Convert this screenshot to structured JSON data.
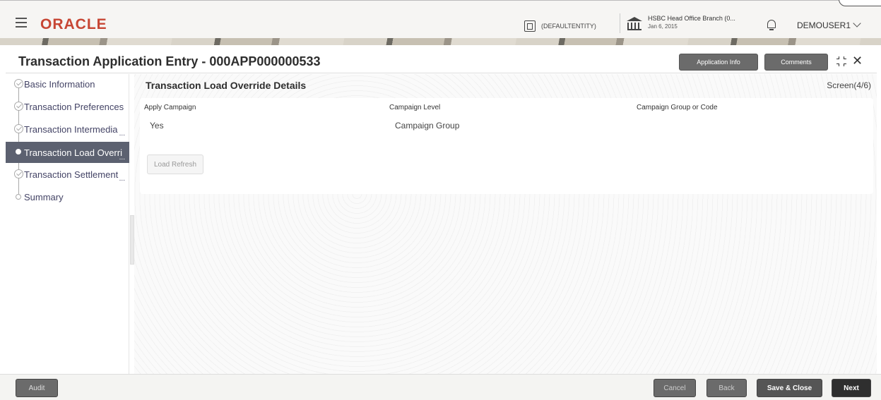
{
  "header": {
    "brand": "ORACLE",
    "entity": "(DEFAULTENTITY)",
    "branch_name": "HSBC Head Office Branch (0...",
    "branch_date": "Jan 6, 2015",
    "user": "DEMOUSER1"
  },
  "titlebar": {
    "title": "Transaction Application Entry - 000APP000000533",
    "application_info": "Application Info",
    "comments": "Comments"
  },
  "sidebar": {
    "items": [
      {
        "label": "Basic Information",
        "state": "done"
      },
      {
        "label": "Transaction Preferences",
        "state": "done"
      },
      {
        "label": "Transaction Intermedia",
        "state": "done"
      },
      {
        "label": "Transaction Load Overri",
        "state": "active"
      },
      {
        "label": "Transaction Settlement",
        "state": "done"
      },
      {
        "label": "Summary",
        "state": "pending"
      }
    ]
  },
  "main": {
    "section_title": "Transaction Load Override Details",
    "screen_indicator": "Screen(4/6)",
    "fields": {
      "apply_campaign_label": "Apply Campaign",
      "apply_campaign_value": "Yes",
      "campaign_level_label": "Campaign Level",
      "campaign_level_value": "Campaign Group",
      "campaign_group_label": "Campaign Group or Code",
      "campaign_group_value": ""
    },
    "load_refresh": "Load Refresh"
  },
  "footer": {
    "audit": "Audit",
    "cancel": "Cancel",
    "back": "Back",
    "save_close": "Save & Close",
    "next": "Next"
  },
  "icons": [
    "hamburger-menu-icon",
    "entity-icon",
    "bank-icon",
    "bell-icon",
    "chevron-down-icon",
    "minimize-icon",
    "close-icon",
    "check-circle-icon"
  ]
}
